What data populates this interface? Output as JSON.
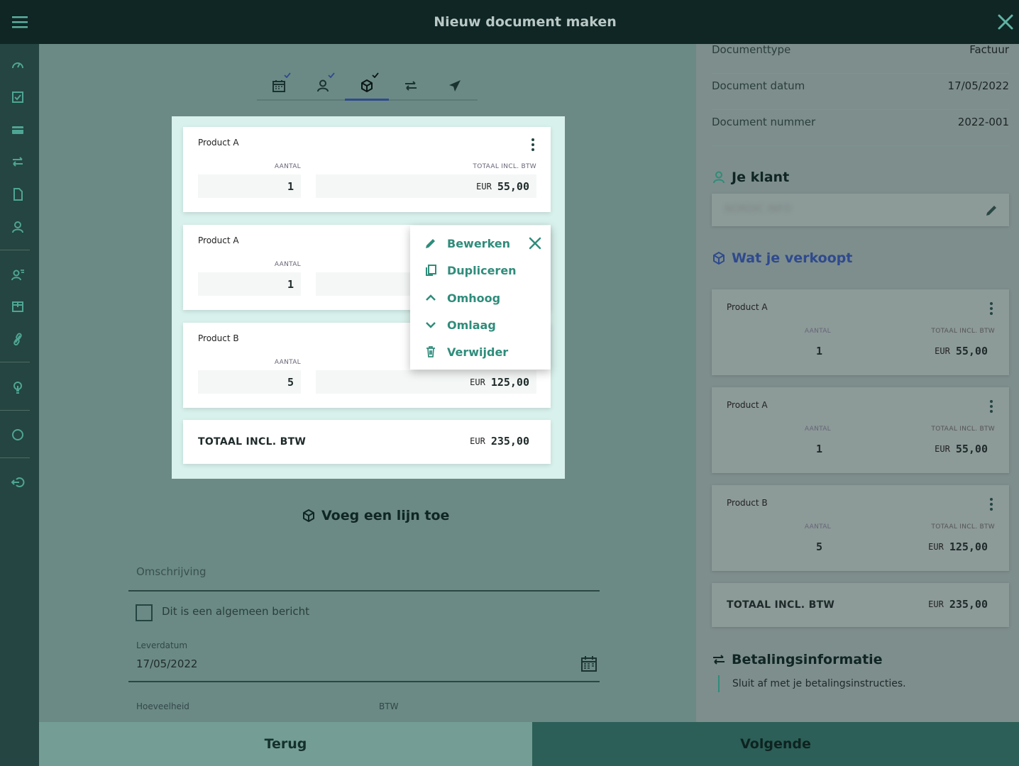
{
  "header": {
    "title": "Nieuw document maken"
  },
  "colors": {
    "accent": "#2f8c7b",
    "step_indicator": "#2f4a8e",
    "dark_bar": "#0f2624",
    "sidebar": "#244541"
  },
  "sidebar": {
    "icons": [
      "dashboard-icon",
      "tasks-icon",
      "card-icon",
      "transfer-icon",
      "document-icon",
      "contacts-icon",
      "team-icon",
      "products-icon",
      "link-icon",
      "idea-icon",
      "circle-icon",
      "logout-icon"
    ]
  },
  "steps": [
    {
      "icon": "calendar-icon",
      "done": true
    },
    {
      "icon": "user-icon",
      "done": true
    },
    {
      "icon": "box-icon",
      "done": true,
      "active": true
    },
    {
      "icon": "transfer-icon",
      "done": false
    },
    {
      "icon": "send-icon",
      "done": false
    }
  ],
  "lines": {
    "qty_label": "AANTAL",
    "total_label": "TOTAAL INCL. BTW",
    "currency": "EUR",
    "items": [
      {
        "name": "Product A",
        "qty": "1",
        "total": "55,00"
      },
      {
        "name": "Product A",
        "qty": "1",
        "total": ""
      },
      {
        "name": "Product B",
        "qty": "5",
        "total": "125,00"
      }
    ],
    "grand_total_label": "TOTAAL INCL. BTW",
    "grand_total": "235,00"
  },
  "context_menu": {
    "items": [
      {
        "label": "Bewerken",
        "icon": "pencil-icon"
      },
      {
        "label": "Dupliceren",
        "icon": "copy-icon"
      },
      {
        "label": "Omhoog",
        "icon": "chevron-up-icon"
      },
      {
        "label": "Omlaag",
        "icon": "chevron-down-icon"
      },
      {
        "label": "Verwijder",
        "icon": "trash-icon"
      }
    ]
  },
  "form": {
    "add_line": "Voeg een lijn toe",
    "description_placeholder": "Omschrijving",
    "general_message_label": "Dit is een algemeen bericht",
    "delivery_label": "Leverdatum",
    "delivery_value": "17/05/2022",
    "quantity_label": "Hoeveelheid",
    "vat_label": "BTW"
  },
  "summary": {
    "rows": [
      {
        "key": "Documenttype",
        "value": "Factuur"
      },
      {
        "key": "Document datum",
        "value": "17/05/2022"
      },
      {
        "key": "Document nummer",
        "value": "2022-001"
      }
    ],
    "client_heading": "Je klant",
    "client_name": "NORDIC INFO",
    "sell_heading": "Wat je verkoopt",
    "items": [
      {
        "name": "Product A",
        "qty": "1",
        "total": "55,00"
      },
      {
        "name": "Product A",
        "qty": "1",
        "total": "55,00"
      },
      {
        "name": "Product B",
        "qty": "5",
        "total": "125,00"
      }
    ],
    "grand_total_label": "TOTAAL INCL. BTW",
    "grand_total": "235,00",
    "payment_heading": "Betalingsinformatie",
    "payment_note": "Sluit af met je betalingsinstructies."
  },
  "footer": {
    "back": "Terug",
    "next": "Volgende"
  }
}
